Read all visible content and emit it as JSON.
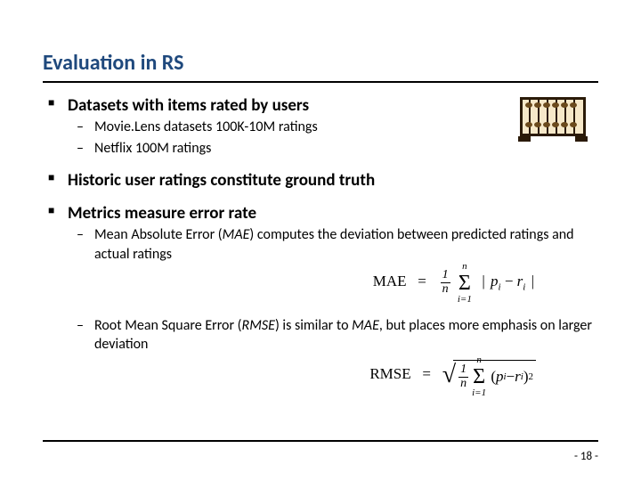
{
  "title": "Evaluation in RS",
  "bullets": {
    "b1": {
      "label": "Datasets with items rated by users",
      "s1": "Movie.Lens datasets 100K-10M ratings",
      "s2": "Netflix 100M ratings"
    },
    "b2": {
      "label": "Historic user ratings constitute ground truth"
    },
    "b3": {
      "label": "Metrics measure error rate",
      "s1a": "Mean Absolute Error (",
      "s1b": "MAE",
      "s1c": ") computes the deviation between predicted ratings and actual ratings",
      "s2a": "Root Mean Square Error (",
      "s2b": "RMSE",
      "s2c": ") is similar to ",
      "s2d": "MAE",
      "s2e": ", but places more emphasis on larger deviation"
    }
  },
  "formulas": {
    "mae": {
      "lhs": "MAE",
      "eq": "=",
      "num": "1",
      "den": "n",
      "sigma": "Σ",
      "lim_top": "n",
      "lim_bot": "i=1",
      "bar": "|",
      "p": "p",
      "minus": "−",
      "r": "r",
      "sub": "i"
    },
    "rmse": {
      "lhs": "RMSE",
      "eq": "=",
      "num": "1",
      "den": "n",
      "sigma": "Σ",
      "lim_top": "n",
      "lim_bot": "i=1",
      "lp": "(",
      "p": "p",
      "minus": "−",
      "r": "r",
      "sub": "i",
      "rp": ")",
      "sq": "2"
    }
  },
  "page": "- 18 -"
}
